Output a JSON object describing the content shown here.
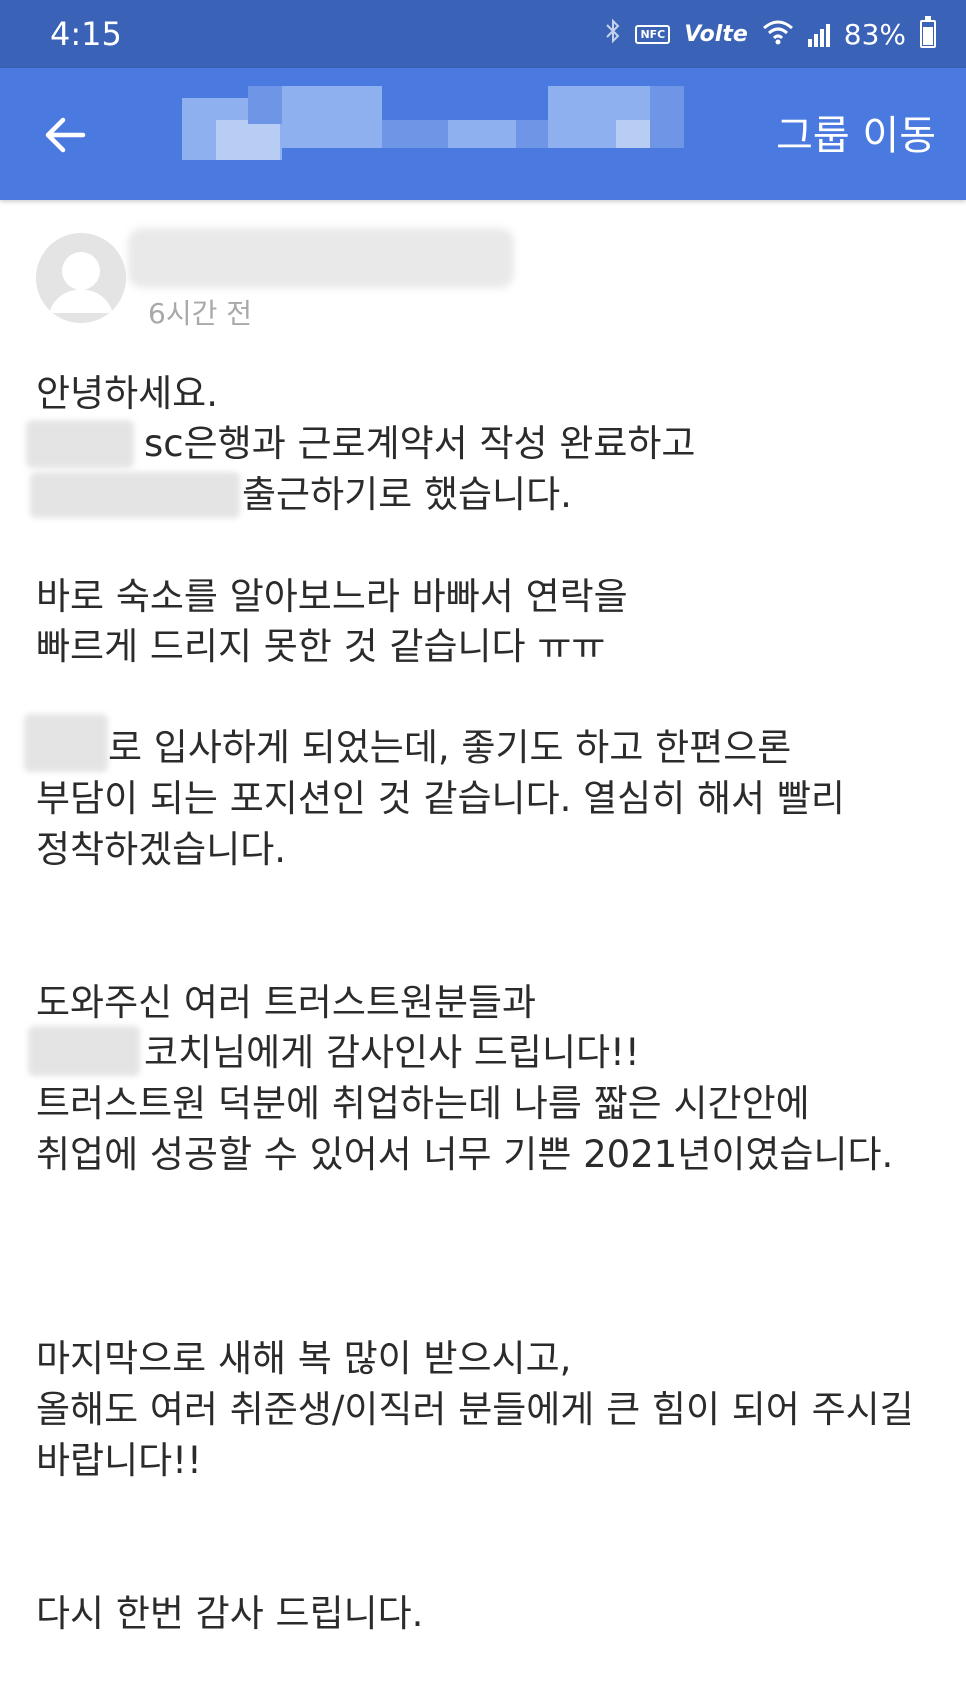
{
  "status_bar": {
    "time": "4:15",
    "icons": [
      "bluetooth-icon",
      "nfc-icon",
      "volte-icon",
      "wifi-icon",
      "signal-icon",
      "battery-icon"
    ],
    "nfc_label": "NFC",
    "volte_label": "Volte",
    "battery_percent": "83%",
    "battery_level": 0.83
  },
  "app_bar": {
    "back_icon": "arrow-left-icon",
    "action_label": "그룹 이동"
  },
  "post": {
    "time_ago": "6시간 전",
    "lines": [
      "안녕하세요.",
      "sc은행과 근로계약서 작성 완료하고",
      "출근하기로 했습니다.",
      "바로 숙소를 알아보느라 바빠서 연락을",
      "빠르게 드리지 못한 것 같습니다 ㅠㅠ",
      "로 입사하게 되었는데, 좋기도 하고 한편으론",
      "부담이 되는 포지션인 것 같습니다. 열심히 해서 빨리",
      "정착하겠습니다.",
      "도와주신 여러 트러스트원분들과",
      "코치님에게 감사인사 드립니다!!",
      "트러스트원 덕분에 취업하는데 나름 짧은 시간안에",
      "취업에 성공할 수 있어서 너무 기쁜 2021년이였습니다.",
      "마지막으로 새해 복 많이 받으시고,",
      "올해도 여러 취준생/이직러 분들에게 큰 힘이 되어 주시길",
      "바랍니다!!",
      "다시 한번 감사 드립니다."
    ]
  },
  "colors": {
    "status_bar": "#3a62b6",
    "app_bar": "#4a7ae0",
    "text": "#2b2b2b",
    "meta_text": "#a9a9a9"
  }
}
